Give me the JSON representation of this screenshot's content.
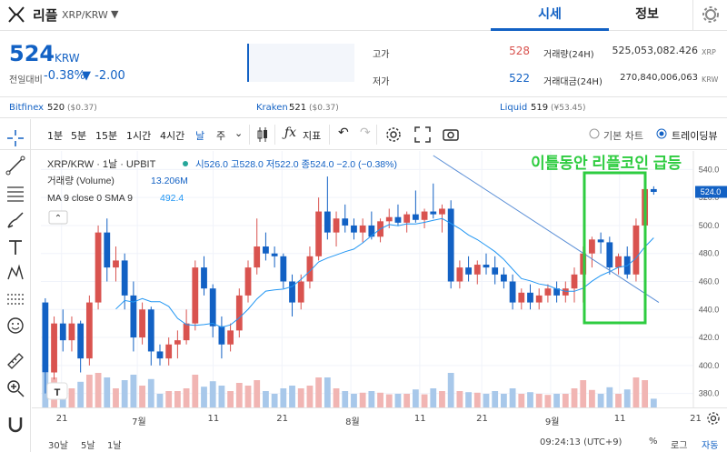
{
  "header": {
    "coin_name": "리플",
    "pair": "XRP/KRW",
    "tab_price": "시세",
    "tab_info": "정보"
  },
  "price": {
    "value": "524",
    "unit": "KRW",
    "change_label": "전일대비",
    "change_pct": "-0.38%",
    "change_amount": "▼ -2.00"
  },
  "stats": {
    "high_label": "고가",
    "high": "528",
    "low_label": "저가",
    "low": "522",
    "volume_label": "거래량(24H)",
    "volume": "525,053,082.426",
    "volume_unit": "XRP",
    "amount_label": "거래대금(24H)",
    "amount": "270,840,006,063",
    "amount_unit": "KRW"
  },
  "exchanges": [
    {
      "name": "Bitfinex",
      "value": "520",
      "sub": "($0.37)"
    },
    {
      "name": "Kraken",
      "value": "521",
      "sub": "($0.37)"
    },
    {
      "name": "Liquid",
      "value": "519",
      "sub": "(¥53.45)"
    }
  ],
  "toolbar": {
    "intervals": [
      "1분",
      "5분",
      "15분",
      "1시간",
      "4시간",
      "날",
      "주"
    ],
    "indicator_label": "지표",
    "basic_chart": "기본 차트",
    "trading_view": "트레이딩뷰"
  },
  "legend": {
    "symbol": "XRP/KRW · 1날 · UPBIT",
    "ohlc": "시526.0 고528.0 저522.0 종524.0 −2.0 (−0.38%)",
    "volume_label": "거래량 (Volume)",
    "volume_value": "13.206M",
    "ma_label": "MA 9 close 0 SMA 9",
    "ma_value": "492.4"
  },
  "annotation": "이틀동안 리플코인 급등",
  "colors": {
    "up": "#d9534f",
    "down": "#1261c4",
    "vol_up": "#f1b5b3",
    "vol_down": "#a8c8ea",
    "annotation": "#2ecc40",
    "ma": "#2196f3"
  },
  "chart_data": {
    "type": "candlestick",
    "ylim": [
      370,
      550
    ],
    "y_ticks": [
      380,
      400,
      420,
      440,
      460,
      480,
      500,
      520,
      540
    ],
    "x_tick_labels": [
      "21",
      "7월",
      "11",
      "21",
      "8월",
      "11",
      "21",
      "9월",
      "11",
      "21"
    ],
    "last_price_label": "524.0",
    "candles": [
      {
        "o": 445,
        "h": 448,
        "l": 380,
        "c": 395
      },
      {
        "o": 395,
        "h": 435,
        "l": 390,
        "c": 430
      },
      {
        "o": 430,
        "h": 440,
        "l": 410,
        "c": 418
      },
      {
        "o": 418,
        "h": 435,
        "l": 410,
        "c": 430
      },
      {
        "o": 430,
        "h": 432,
        "l": 395,
        "c": 405
      },
      {
        "o": 405,
        "h": 450,
        "l": 400,
        "c": 445
      },
      {
        "o": 445,
        "h": 500,
        "l": 440,
        "c": 495
      },
      {
        "o": 495,
        "h": 505,
        "l": 460,
        "c": 470
      },
      {
        "o": 470,
        "h": 485,
        "l": 460,
        "c": 475
      },
      {
        "o": 475,
        "h": 480,
        "l": 440,
        "c": 450
      },
      {
        "o": 450,
        "h": 460,
        "l": 410,
        "c": 420
      },
      {
        "o": 420,
        "h": 445,
        "l": 415,
        "c": 440
      },
      {
        "o": 440,
        "h": 442,
        "l": 400,
        "c": 410
      },
      {
        "o": 410,
        "h": 415,
        "l": 400,
        "c": 405
      },
      {
        "o": 405,
        "h": 420,
        "l": 400,
        "c": 415
      },
      {
        "o": 415,
        "h": 425,
        "l": 405,
        "c": 418
      },
      {
        "o": 418,
        "h": 440,
        "l": 415,
        "c": 430
      },
      {
        "o": 430,
        "h": 475,
        "l": 425,
        "c": 470
      },
      {
        "o": 470,
        "h": 478,
        "l": 450,
        "c": 455
      },
      {
        "o": 455,
        "h": 458,
        "l": 420,
        "c": 428
      },
      {
        "o": 428,
        "h": 435,
        "l": 405,
        "c": 415
      },
      {
        "o": 415,
        "h": 430,
        "l": 410,
        "c": 425
      },
      {
        "o": 425,
        "h": 455,
        "l": 420,
        "c": 450
      },
      {
        "o": 450,
        "h": 475,
        "l": 445,
        "c": 470
      },
      {
        "o": 470,
        "h": 505,
        "l": 465,
        "c": 485
      },
      {
        "o": 485,
        "h": 495,
        "l": 475,
        "c": 480
      },
      {
        "o": 480,
        "h": 485,
        "l": 470,
        "c": 478
      },
      {
        "o": 478,
        "h": 480,
        "l": 455,
        "c": 460
      },
      {
        "o": 460,
        "h": 465,
        "l": 435,
        "c": 445
      },
      {
        "o": 445,
        "h": 465,
        "l": 440,
        "c": 460
      },
      {
        "o": 460,
        "h": 485,
        "l": 455,
        "c": 478
      },
      {
        "o": 478,
        "h": 520,
        "l": 475,
        "c": 510
      },
      {
        "o": 510,
        "h": 535,
        "l": 490,
        "c": 495
      },
      {
        "o": 495,
        "h": 510,
        "l": 485,
        "c": 505
      },
      {
        "o": 505,
        "h": 515,
        "l": 495,
        "c": 500
      },
      {
        "o": 500,
        "h": 505,
        "l": 490,
        "c": 495
      },
      {
        "o": 495,
        "h": 505,
        "l": 488,
        "c": 500
      },
      {
        "o": 500,
        "h": 510,
        "l": 490,
        "c": 492
      },
      {
        "o": 492,
        "h": 505,
        "l": 488,
        "c": 503
      },
      {
        "o": 503,
        "h": 512,
        "l": 498,
        "c": 506
      },
      {
        "o": 506,
        "h": 515,
        "l": 500,
        "c": 502
      },
      {
        "o": 502,
        "h": 510,
        "l": 495,
        "c": 508
      },
      {
        "o": 508,
        "h": 525,
        "l": 502,
        "c": 504
      },
      {
        "o": 504,
        "h": 512,
        "l": 498,
        "c": 510
      },
      {
        "o": 510,
        "h": 530,
        "l": 505,
        "c": 508
      },
      {
        "o": 508,
        "h": 515,
        "l": 495,
        "c": 512
      },
      {
        "o": 512,
        "h": 518,
        "l": 455,
        "c": 460
      },
      {
        "o": 460,
        "h": 475,
        "l": 455,
        "c": 470
      },
      {
        "o": 470,
        "h": 478,
        "l": 460,
        "c": 465
      },
      {
        "o": 465,
        "h": 475,
        "l": 458,
        "c": 472
      },
      {
        "o": 472,
        "h": 480,
        "l": 465,
        "c": 470
      },
      {
        "o": 470,
        "h": 478,
        "l": 458,
        "c": 465
      },
      {
        "o": 465,
        "h": 470,
        "l": 455,
        "c": 460
      },
      {
        "o": 460,
        "h": 465,
        "l": 440,
        "c": 445
      },
      {
        "o": 445,
        "h": 455,
        "l": 440,
        "c": 452
      },
      {
        "o": 452,
        "h": 458,
        "l": 440,
        "c": 445
      },
      {
        "o": 445,
        "h": 455,
        "l": 440,
        "c": 450
      },
      {
        "o": 450,
        "h": 458,
        "l": 445,
        "c": 455
      },
      {
        "o": 455,
        "h": 460,
        "l": 445,
        "c": 450
      },
      {
        "o": 450,
        "h": 460,
        "l": 445,
        "c": 455
      },
      {
        "o": 455,
        "h": 470,
        "l": 445,
        "c": 465
      },
      {
        "o": 465,
        "h": 485,
        "l": 445,
        "c": 480
      },
      {
        "o": 480,
        "h": 492,
        "l": 470,
        "c": 490
      },
      {
        "o": 490,
        "h": 495,
        "l": 480,
        "c": 488
      },
      {
        "o": 488,
        "h": 492,
        "l": 465,
        "c": 470
      },
      {
        "o": 470,
        "h": 480,
        "l": 465,
        "c": 478
      },
      {
        "o": 478,
        "h": 485,
        "l": 462,
        "c": 465
      },
      {
        "o": 465,
        "h": 505,
        "l": 460,
        "c": 500
      },
      {
        "o": 500,
        "h": 535,
        "l": 495,
        "c": 526
      },
      {
        "o": 526,
        "h": 528,
        "l": 522,
        "c": 524
      }
    ]
  }
}
